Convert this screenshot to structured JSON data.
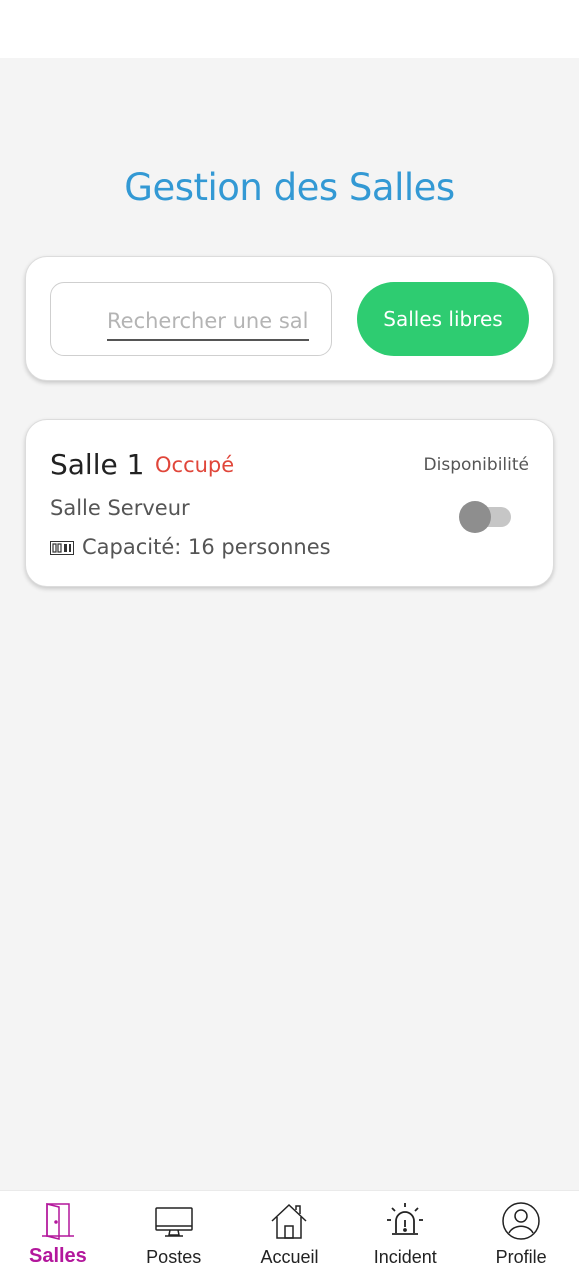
{
  "header": {
    "title": "Gestion des Salles"
  },
  "search": {
    "placeholder": "Rechercher une sal",
    "value": ""
  },
  "filter_button": {
    "label": "Salles libres",
    "color": "#2ecc71"
  },
  "rooms": [
    {
      "name": "Salle 1",
      "status": "Occupé",
      "status_color": "#e0463a",
      "type": "Salle Serveur",
      "capacity_icon": "people-counter-icon",
      "capacity": "Capacité: 16 personnes",
      "availability_label": "Disponibilité",
      "available": false
    }
  ],
  "nav": {
    "items": [
      {
        "label": "Salles",
        "icon": "door-icon",
        "active": true
      },
      {
        "label": "Postes",
        "icon": "monitor-icon",
        "active": false
      },
      {
        "label": "Accueil",
        "icon": "home-icon",
        "active": false
      },
      {
        "label": "Incident",
        "icon": "alarm-icon",
        "active": false
      },
      {
        "label": "Profile",
        "icon": "user-circle-icon",
        "active": false
      }
    ],
    "active_color": "#b3179c"
  },
  "colors": {
    "title": "#3399d4",
    "background": "#f4f4f4"
  }
}
